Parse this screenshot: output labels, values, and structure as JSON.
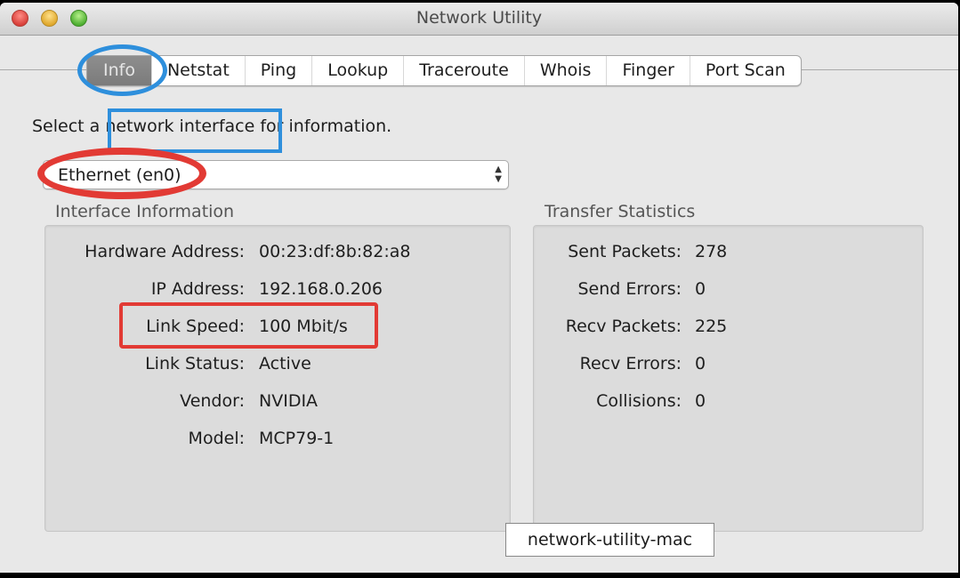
{
  "window": {
    "title": "Network Utility",
    "traffic_lights": [
      "close",
      "minimize",
      "zoom"
    ]
  },
  "tabs": [
    {
      "label": "Info",
      "active": true
    },
    {
      "label": "Netstat",
      "active": false
    },
    {
      "label": "Ping",
      "active": false
    },
    {
      "label": "Lookup",
      "active": false
    },
    {
      "label": "Traceroute",
      "active": false
    },
    {
      "label": "Whois",
      "active": false
    },
    {
      "label": "Finger",
      "active": false
    },
    {
      "label": "Port Scan",
      "active": false
    }
  ],
  "prompt": {
    "before": "Select a ",
    "highlight": "network interface",
    "after": " for information."
  },
  "interface_select": {
    "value": "Ethernet (en0)",
    "icon": "up-down-arrows-icon"
  },
  "interface_info": {
    "title": "Interface Information",
    "rows": [
      {
        "label": "Hardware Address:",
        "value": "00:23:df:8b:82:a8"
      },
      {
        "label": "IP Address:",
        "value": "192.168.0.206"
      },
      {
        "label": "Link Speed:",
        "value": "100 Mbit/s"
      },
      {
        "label": "Link Status:",
        "value": "Active"
      },
      {
        "label": "Vendor:",
        "value": "NVIDIA"
      },
      {
        "label": "Model:",
        "value": "MCP79-1"
      }
    ]
  },
  "transfer_stats": {
    "title": "Transfer Statistics",
    "rows": [
      {
        "label": "Sent Packets:",
        "value": "278"
      },
      {
        "label": "Send Errors:",
        "value": "0"
      },
      {
        "label": "Recv Packets:",
        "value": "225"
      },
      {
        "label": "Recv Errors:",
        "value": "0"
      },
      {
        "label": "Collisions:",
        "value": "0"
      }
    ]
  },
  "annotations": {
    "blue": "#2e8fdc",
    "red": "#e23a34"
  },
  "caption": "network-utility-mac"
}
